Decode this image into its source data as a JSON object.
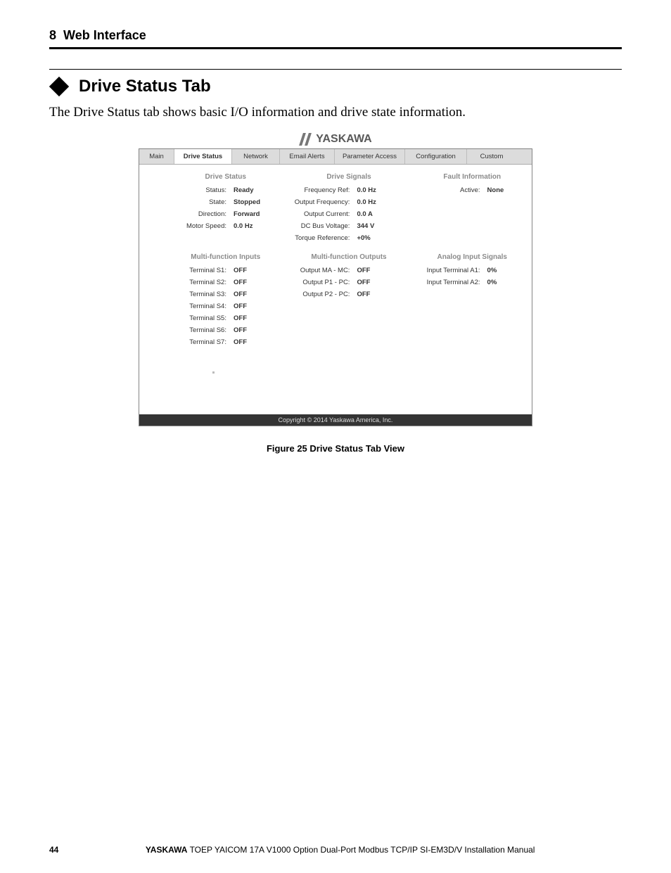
{
  "header": {
    "chapter": "8",
    "title": "Web Interface"
  },
  "section": {
    "title": "Drive Status Tab"
  },
  "intro": "The Drive Status tab shows basic I/O information and drive state information.",
  "brand": "YASKAWA",
  "tabs": {
    "main": "Main",
    "drive_status": "Drive Status",
    "network": "Network",
    "email_alerts": "Email Alerts",
    "parameter_access": "Parameter Access",
    "configuration": "Configuration",
    "custom": "Custom"
  },
  "top": {
    "drive_status": {
      "heading": "Drive Status",
      "rows": [
        {
          "k": "Status:",
          "v": "Ready"
        },
        {
          "k": "State:",
          "v": "Stopped"
        },
        {
          "k": "Direction:",
          "v": "Forward"
        },
        {
          "k": "Motor Speed:",
          "v": "0.0 Hz"
        }
      ]
    },
    "drive_signals": {
      "heading": "Drive Signals",
      "rows": [
        {
          "k": "Frequency Ref:",
          "v": "0.0 Hz"
        },
        {
          "k": "Output Frequency:",
          "v": "0.0 Hz"
        },
        {
          "k": "Output Current:",
          "v": "0.0 A"
        },
        {
          "k": "DC Bus Voltage:",
          "v": "344 V"
        },
        {
          "k": "Torque Reference:",
          "v": "+0%"
        }
      ]
    },
    "fault_info": {
      "heading": "Fault Information",
      "rows": [
        {
          "k": "Active:",
          "v": "None"
        }
      ]
    }
  },
  "bottom": {
    "mfi": {
      "heading": "Multi-function Inputs",
      "rows": [
        {
          "k": "Terminal S1:",
          "v": "OFF"
        },
        {
          "k": "Terminal S2:",
          "v": "OFF"
        },
        {
          "k": "Terminal S3:",
          "v": "OFF"
        },
        {
          "k": "Terminal S4:",
          "v": "OFF"
        },
        {
          "k": "Terminal S5:",
          "v": "OFF"
        },
        {
          "k": "Terminal S6:",
          "v": "OFF"
        },
        {
          "k": "Terminal S7:",
          "v": "OFF"
        }
      ]
    },
    "mfo": {
      "heading": "Multi-function Outputs",
      "rows": [
        {
          "k": "Output MA - MC:",
          "v": "OFF"
        },
        {
          "k": "Output P1 - PC:",
          "v": "OFF"
        },
        {
          "k": "Output P2 - PC:",
          "v": "OFF"
        }
      ]
    },
    "ais": {
      "heading": "Analog Input Signals",
      "rows": [
        {
          "k": "Input Terminal A1:",
          "v": "0%"
        },
        {
          "k": "Input Terminal A2:",
          "v": "0%"
        }
      ]
    }
  },
  "copyright": "Copyright © 2014 Yaskawa America, Inc.",
  "figure": "Figure 25   Drive Status Tab View",
  "footer": {
    "page": "44",
    "brand": "YASKAWA",
    "doc": " TOEP YAICOM 17A V1000 Option Dual-Port Modbus TCP/IP SI-EM3D/V Installation Manual"
  }
}
